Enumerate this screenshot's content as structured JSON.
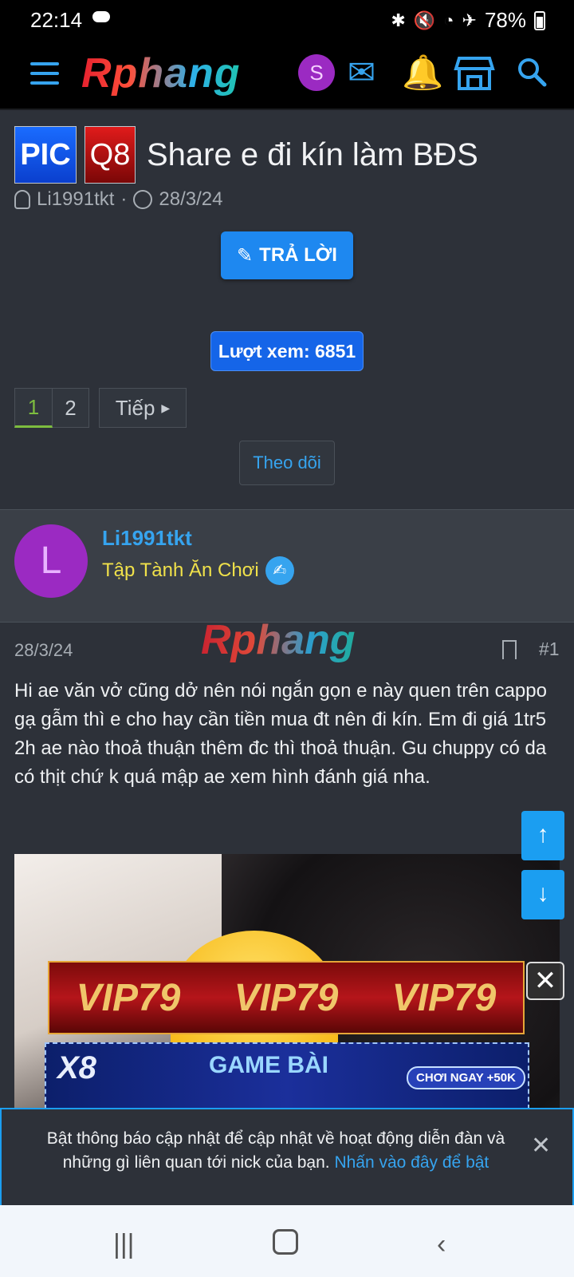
{
  "status_bar": {
    "time": "22:14",
    "battery": "78%",
    "icons": [
      "cloud-icon",
      "bluetooth-icon",
      "mute-icon",
      "wifi-icon",
      "airplane-icon",
      "battery-icon"
    ]
  },
  "header": {
    "logo": "Rphang",
    "avatar_letter": "S",
    "icons": [
      "menu-icon",
      "mail-icon",
      "bell-icon",
      "store-icon",
      "search-icon"
    ]
  },
  "thread": {
    "prefix_1": "PIC",
    "prefix_2": "Q8",
    "title": "Share e đi kín làm BĐS",
    "author": "Li1991tkt",
    "date": "28/3/24",
    "reply_label": "TRẢ LỜI",
    "views_label": "Lượt xem: 6851",
    "pages": [
      "1",
      "2"
    ],
    "next_label": "Tiếp",
    "follow_label": "Theo dõi"
  },
  "post": {
    "avatar_letter": "L",
    "username": "Li1991tkt",
    "user_title": "Tập Tành Ăn Chơi",
    "date": "28/3/24",
    "number": "#1",
    "watermark": "Rphang",
    "body": "Hi ae văn vở cũng dở nên nói ngắn gọn e này quen trên cappo gạ gẫm thì e cho hay cần tiền mua đt nên đi kín. Em đi giá 1tr5 2h ae nào thoả thuận thêm đc thì thoả thuận. Gu chuppy có da có thịt chứ k quá mập ae xem hình đánh giá nha."
  },
  "ads": {
    "banner1": [
      "VIP79",
      "VIP79",
      "VIP79"
    ],
    "banner2_logo": "X8",
    "banner2_title": "GAME BÀI",
    "banner2_cta": "CHƠI NGAY +50K"
  },
  "notice": {
    "text": "Bật thông báo cập nhật để cập nhật về hoạt động diễn đàn và những gì liên quan tới nick của bạn.",
    "link": "Nhấn vào đây để bật"
  },
  "colors": {
    "accent": "#36a4ef",
    "background": "#2d3139",
    "user_title": "#f0e14a"
  }
}
